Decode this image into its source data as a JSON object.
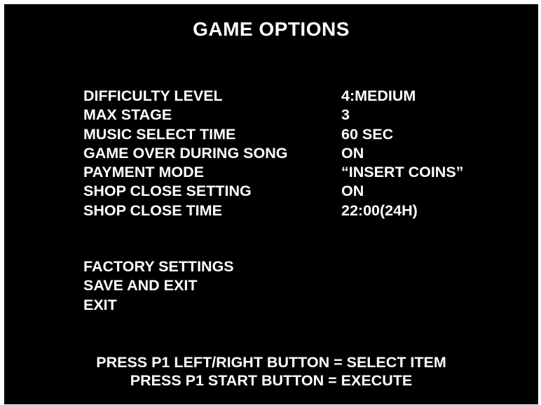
{
  "screen": {
    "title": "GAME OPTIONS",
    "background": "#000000",
    "text_color": "#ffffff"
  },
  "options": [
    {
      "label": "DIFFICULTY LEVEL",
      "value": "4:MEDIUM"
    },
    {
      "label": "MAX STAGE",
      "value": "3"
    },
    {
      "label": "MUSIC SELECT TIME",
      "value": "60 SEC"
    },
    {
      "label": "GAME OVER DURING SONG",
      "value": "ON"
    },
    {
      "label": "PAYMENT MODE",
      "value": "“INSERT COINS”"
    },
    {
      "label": "SHOP CLOSE SETTING",
      "value": "ON"
    },
    {
      "label": "SHOP CLOSE TIME",
      "value": "22:00(24H)"
    }
  ],
  "actions": [
    {
      "label": "FACTORY SETTINGS"
    },
    {
      "label": "SAVE AND EXIT"
    },
    {
      "label": "EXIT"
    }
  ],
  "footer": {
    "line1": "PRESS P1 LEFT/RIGHT BUTTON = SELECT ITEM",
    "line2": "PRESS P1 START BUTTON = EXECUTE"
  }
}
